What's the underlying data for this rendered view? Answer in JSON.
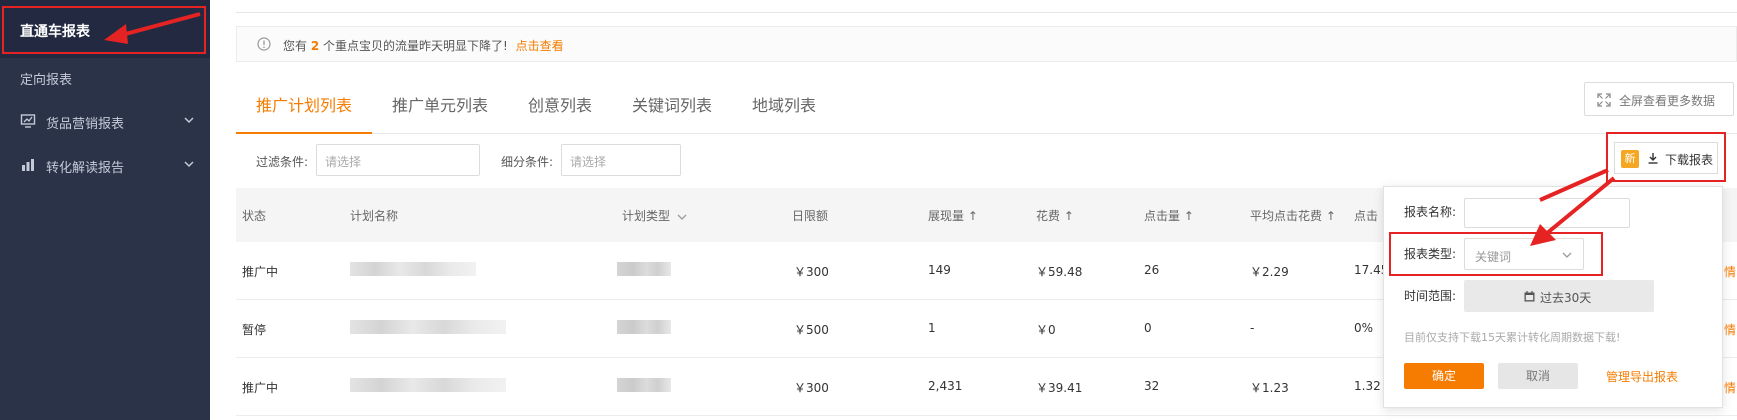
{
  "sidebar": {
    "active_item": "直通车报表",
    "items": [
      {
        "label": "定向报表",
        "has_icon": false,
        "has_chevron": false,
        "icon": ""
      },
      {
        "label": "货品营销报表",
        "has_icon": true,
        "has_chevron": true,
        "icon": "monitor-chart-icon"
      },
      {
        "label": "转化解读报告",
        "has_icon": true,
        "has_chevron": true,
        "icon": "bar-chart-icon"
      }
    ]
  },
  "notice": {
    "prefix": "您有",
    "count": "2",
    "suffix": "个重点宝贝的流量昨天明显下降了!",
    "link": "点击查看"
  },
  "tabs": [
    {
      "label": "推广计划列表",
      "active": true
    },
    {
      "label": "推广单元列表",
      "active": false
    },
    {
      "label": "创意列表",
      "active": false
    },
    {
      "label": "关键词列表",
      "active": false
    },
    {
      "label": "地域列表",
      "active": false
    }
  ],
  "fullscreen_button": "全屏查看更多数据",
  "filters": {
    "filter_label": "过滤条件:",
    "filter_placeholder": "请选择",
    "sub_label": "细分条件:",
    "sub_placeholder": "请选择"
  },
  "download_button": {
    "badge": "新",
    "label": "下载报表"
  },
  "table": {
    "headers": [
      "状态",
      "计划名称",
      "计划类型",
      "日限额",
      "展现量",
      "花费",
      "点击量",
      "平均点击花费",
      "点击率"
    ],
    "header_visible": [
      "状态",
      "计划名称",
      "计划类型",
      "日限额",
      "展现量 ↑",
      "花费 ↑",
      "点击量 ↑",
      "平均点击花费 ↑",
      "点击"
    ],
    "rows": [
      {
        "status": "推广中",
        "budget": "￥300",
        "impressions": "149",
        "cost": "￥59.48",
        "clicks": "26",
        "cpc": "￥2.29",
        "ctr": "17.45"
      },
      {
        "status": "暂停",
        "budget": "￥500",
        "impressions": "1",
        "cost": "￥0",
        "clicks": "0",
        "cpc": "-",
        "ctr": "0%"
      },
      {
        "status": "推广中",
        "budget": "￥300",
        "impressions": "2,431",
        "cost": "￥39.41",
        "clicks": "32",
        "cpc": "￥1.23",
        "ctr": "1.32"
      }
    ]
  },
  "popup": {
    "name_label": "报表名称:",
    "type_label": "报表类型:",
    "type_value": "关键词",
    "range_label": "时间范围:",
    "range_value": "过去30天",
    "note": "目前仅支持下载15天累计转化周期数据下载!",
    "confirm": "确定",
    "cancel": "取消",
    "manage": "管理导出报表"
  },
  "colors": {
    "sidebar_bg": "#2b3349",
    "accent": "#f57c00",
    "highlight_red": "#e62323"
  }
}
